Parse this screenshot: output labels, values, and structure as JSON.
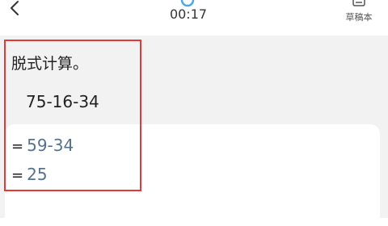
{
  "header": {
    "timer": "00:17",
    "draft_label": "草稿本",
    "icons": {
      "back": "chevron-left-icon",
      "timer": "timer-icon",
      "draft": "draft-book-icon"
    }
  },
  "question": {
    "title": "脱式计算。",
    "expression": "75-16-34"
  },
  "answer": {
    "steps": [
      {
        "prefix": "=",
        "value": "59-34"
      },
      {
        "prefix": "=",
        "value": "25"
      }
    ]
  },
  "colors": {
    "answer_text": "#56728f",
    "highlight": "#e53935",
    "timer_accent": "#4aa8e8"
  }
}
